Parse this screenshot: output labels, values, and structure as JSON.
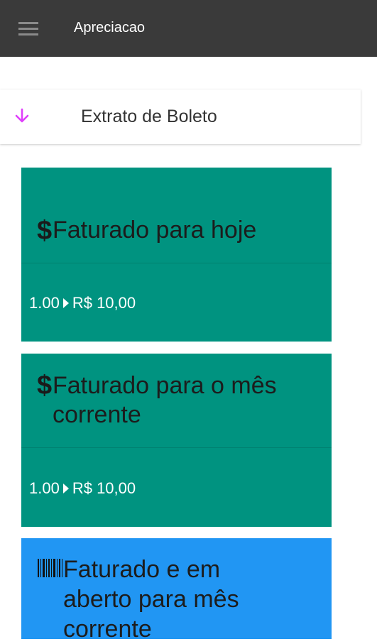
{
  "appbar": {
    "title": "Apreciacao",
    "menu_icon": "menu-icon"
  },
  "section": {
    "title": "Extrato de Boleto",
    "icon": "arrow-down-icon",
    "icon_color": "#e040fb"
  },
  "tiles": [
    {
      "icon_text": "$",
      "title": "Faturado para hoje",
      "amount": "1.00",
      "value": "R$ 10,00",
      "color": "#009380"
    },
    {
      "icon_text": "$",
      "title_line1": "Faturado para o mês",
      "title_line2": "corrente",
      "amount": "1.00",
      "value": "R$ 10,00",
      "color": "#009380"
    },
    {
      "icon": "barcode-icon",
      "title_line1": "Faturado e em",
      "title_line2": "aberto para mês",
      "title_line3": "corrente",
      "color": "#2196f3"
    }
  ]
}
